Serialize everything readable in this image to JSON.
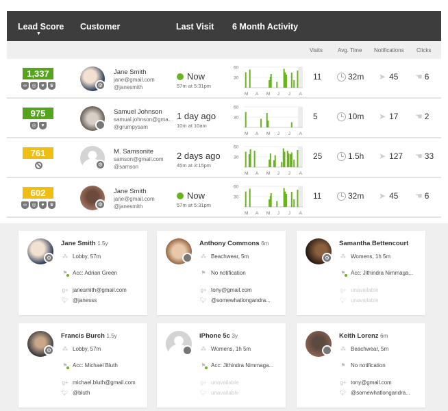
{
  "header": {
    "lead_score": "Lead Score",
    "customer": "Customer",
    "last_visit": "Last Visit",
    "activity": "6 Month Activity",
    "sort_indicator": "▼"
  },
  "subheader": {
    "visits": "Visits",
    "avg_time": "Avg. Time",
    "notifications": "Notifications",
    "clicks": "Clicks"
  },
  "colors": {
    "green": "#55a51c",
    "yellow": "#efbe14",
    "dark_header": "#3d3d3d",
    "bar": "#6ab31f"
  },
  "chart_axis": {
    "y_ticks": [
      "60",
      "30"
    ],
    "months": [
      "M",
      "A",
      "M",
      "J",
      "J",
      "A"
    ],
    "ylim": [
      0,
      60
    ]
  },
  "rows": [
    {
      "score": "1,337",
      "score_color": "green",
      "badges": [
        "link",
        "target",
        "heart",
        "crown"
      ],
      "name": "Jane Smith",
      "email": "jane@gmail.com",
      "handle": "@janesmith",
      "os": "android",
      "visit": "Now",
      "online": true,
      "visit_sub": "57m at 5:31pm",
      "visits": "11",
      "avg_time": "32m",
      "notifications": "45",
      "clicks": "6",
      "activity": [
        [
          0.02,
          45
        ],
        [
          0.09,
          53
        ],
        [
          0.42,
          22
        ],
        [
          0.44,
          32
        ],
        [
          0.45,
          40
        ],
        [
          0.55,
          17
        ],
        [
          0.67,
          55
        ],
        [
          0.69,
          45
        ],
        [
          0.71,
          38
        ],
        [
          0.8,
          44
        ],
        [
          0.84,
          22
        ],
        [
          0.9,
          50
        ]
      ]
    },
    {
      "score": "975",
      "score_color": "green",
      "badges": [
        "target",
        "heart"
      ],
      "name": "Samuel Johnson",
      "email": "samual.johnson@gmail.com",
      "handle": "@grumpysam",
      "os": "apple",
      "visit": "1 day ago",
      "online": false,
      "visit_sub": "10m at 10am",
      "visits": "5",
      "avg_time": "10m",
      "notifications": "17",
      "clicks": "2",
      "activity": [
        [
          0.02,
          45
        ],
        [
          0.28,
          25
        ],
        [
          0.38,
          42
        ],
        [
          0.4,
          20
        ],
        [
          0.8,
          15
        ]
      ]
    },
    {
      "score": "761",
      "score_color": "yellow",
      "badges": [
        "none"
      ],
      "name": "M. Samsonite",
      "email": "samson@gmail.com",
      "handle": "@samson",
      "os": "android",
      "visit": "2 days ago",
      "online": false,
      "visit_sub": "45m at 3:15pm",
      "visits": "25",
      "avg_time": "1.5h",
      "notifications": "127",
      "clicks": "33",
      "activity": [
        [
          0.02,
          45
        ],
        [
          0.08,
          38
        ],
        [
          0.1,
          52
        ],
        [
          0.17,
          48
        ],
        [
          0.42,
          22
        ],
        [
          0.44,
          40
        ],
        [
          0.5,
          20
        ],
        [
          0.52,
          35
        ],
        [
          0.63,
          15
        ],
        [
          0.66,
          55
        ],
        [
          0.68,
          45
        ],
        [
          0.73,
          48
        ],
        [
          0.75,
          40
        ],
        [
          0.78,
          38
        ],
        [
          0.8,
          43
        ],
        [
          0.84,
          22
        ],
        [
          0.9,
          50
        ]
      ]
    },
    {
      "score": "602",
      "score_color": "yellow",
      "badges": [
        "link",
        "target",
        "heart",
        "crown"
      ],
      "name": "Jane Smith",
      "email": "jane@gmail.com",
      "handle": "@janesmith",
      "os": "android",
      "visit": "Now",
      "online": true,
      "visit_sub": "57m at 5:31pm",
      "visits": "11",
      "avg_time": "32m",
      "notifications": "45",
      "clicks": "6",
      "activity": [
        [
          0.02,
          45
        ],
        [
          0.09,
          53
        ],
        [
          0.42,
          22
        ],
        [
          0.44,
          32
        ],
        [
          0.45,
          40
        ],
        [
          0.55,
          17
        ],
        [
          0.67,
          55
        ],
        [
          0.69,
          45
        ],
        [
          0.71,
          38
        ],
        [
          0.8,
          44
        ],
        [
          0.84,
          22
        ],
        [
          0.9,
          50
        ]
      ]
    }
  ],
  "cards": [
    {
      "name": "Jane Smith",
      "age": "1.5y",
      "os": "android",
      "location": "Lobby, 57m",
      "notification": "Acc: Adrian Green",
      "notified": true,
      "email": "janesmith@gmail.com",
      "twitter": "@janesss",
      "available": true
    },
    {
      "name": "Anthony Commons",
      "age": "6m",
      "os": "apple",
      "location": "Beachwear, 5m",
      "notification": "No notification",
      "notified": false,
      "email": "tony@gmail.com",
      "twitter": "@somewhatlongandra...",
      "available": true
    },
    {
      "name": "Samantha Bettencourt",
      "age": "",
      "os": "android",
      "location": "Womens, 1h 5m",
      "notification": "Acc: Jithindra Nimmaga...",
      "notified": true,
      "email": "unavailable",
      "twitter": "unavailable",
      "available": false
    },
    {
      "name": "Francis Burch",
      "age": "1.5y",
      "os": "android",
      "location": "Lobby, 57m",
      "notification": "Acc: Michael Bluth",
      "notified": true,
      "email": "michael.bluth@gmail.com",
      "twitter": "@bluth",
      "available": true
    },
    {
      "name": "iPhone 5c",
      "age": "3y",
      "os": "apple",
      "location": "Womens, 1h 5m",
      "notification": "Acc: Jithindra Nimmaga...",
      "notified": true,
      "email": "unavailable",
      "twitter": "unavailable",
      "available": false
    },
    {
      "name": "Keith Lorenz",
      "age": "6m",
      "os": "apple",
      "location": "Beachwear, 5m",
      "notification": "No notification",
      "notified": false,
      "email": "tony@gmail.com",
      "twitter": "@somewhatlongandra...",
      "available": true
    }
  ]
}
